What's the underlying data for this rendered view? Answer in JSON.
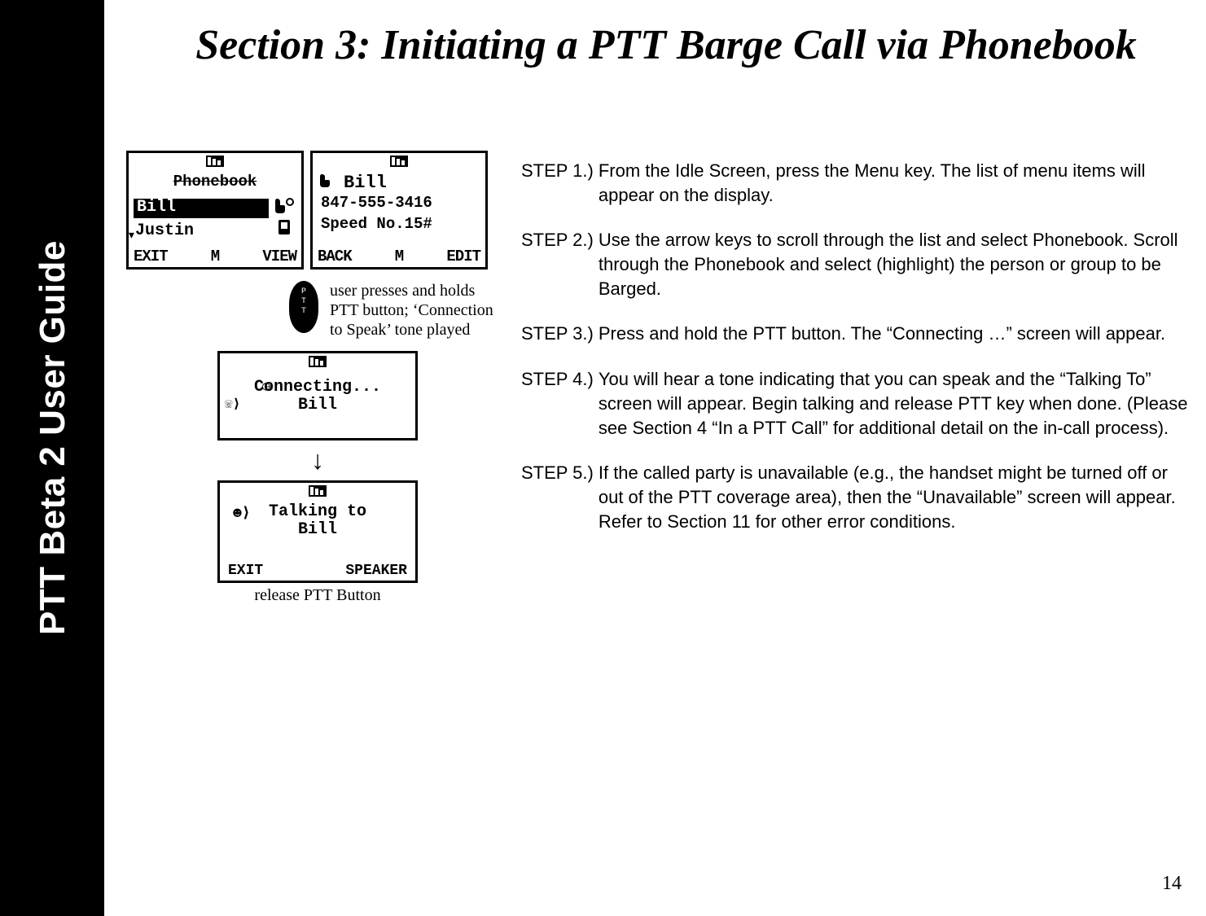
{
  "sidebar_title": "PTT Beta 2 User Guide",
  "heading": "Section 3: Initiating a PTT Barge Call via Phonebook",
  "page_number": "14",
  "steps": [
    {
      "label": "STEP 1.)",
      "body": "From the Idle Screen, press the Menu key. The list of menu items will appear on the display."
    },
    {
      "label": "STEP 2.)",
      "body": "Use the arrow keys to scroll through the list and select Phonebook.  Scroll through the Phonebook and select (highlight) the person or group to be Barged."
    },
    {
      "label": "STEP 3.)",
      "body": "Press and hold the PTT button.  The “Connecting …” screen will appear."
    },
    {
      "label": "STEP 4.)",
      "body": "You will hear a tone indicating that you can speak and the “Talking To” screen will appear. Begin talking and release PTT key when done. (Please see Section 4 “In a PTT Call” for additional detail on the in-call process)."
    },
    {
      "label": "STEP 5.)",
      "body": "If the called party is unavailable (e.g., the handset might be turned off or out of the PTT coverage area), then the “Unavailable” screen will appear. Refer to Section 11 for other error conditions."
    }
  ],
  "screen1": {
    "title": "Phonebook",
    "selected": "Bill",
    "item2": "Justin",
    "soft_left": "EXIT",
    "soft_mid": "M",
    "soft_right": "VIEW"
  },
  "screen2": {
    "name": "Bill",
    "number": "847-555-3416",
    "speed": "Speed No.15#",
    "soft_left": "BACK",
    "soft_mid": "M",
    "soft_right": "EDIT"
  },
  "ptt": {
    "button_label": "P T T b",
    "note": "user presses and holds  PTT button; ‘Connection to Speak’ tone played"
  },
  "screen3": {
    "line1": "Connecting...",
    "line2": "Bill"
  },
  "screen4": {
    "line1": "Talking to",
    "line2": "Bill",
    "soft_left": "EXIT",
    "soft_right": "SPEAKER"
  },
  "release_note": "release PTT Button"
}
